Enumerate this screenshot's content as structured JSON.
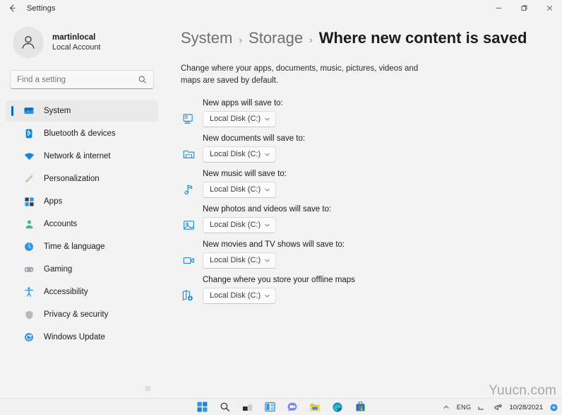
{
  "window": {
    "title": "Settings",
    "back_icon": "back-arrow-icon",
    "minimize_label": "─",
    "maximize_label": "❐",
    "close_label": "✕"
  },
  "sidebar": {
    "profile": {
      "name": "martinlocal",
      "subtitle": "Local Account",
      "avatar_icon": "person-avatar-icon"
    },
    "search": {
      "placeholder": "Find a setting",
      "value": "",
      "icon": "search-icon"
    },
    "items": [
      {
        "label": "System",
        "icon": "system-monitor-icon",
        "selected": true
      },
      {
        "label": "Bluetooth & devices",
        "icon": "bluetooth-icon",
        "selected": false
      },
      {
        "label": "Network & internet",
        "icon": "network-wifi-icon",
        "selected": false
      },
      {
        "label": "Personalization",
        "icon": "paintbrush-icon",
        "selected": false
      },
      {
        "label": "Apps",
        "icon": "apps-grid-icon",
        "selected": false
      },
      {
        "label": "Accounts",
        "icon": "accounts-person-icon",
        "selected": false
      },
      {
        "label": "Time & language",
        "icon": "clock-globe-icon",
        "selected": false
      },
      {
        "label": "Gaming",
        "icon": "gaming-controller-icon",
        "selected": false
      },
      {
        "label": "Accessibility",
        "icon": "accessibility-icon",
        "selected": false
      },
      {
        "label": "Privacy & security",
        "icon": "shield-icon",
        "selected": false
      },
      {
        "label": "Windows Update",
        "icon": "windows-update-icon",
        "selected": false
      }
    ]
  },
  "main": {
    "breadcrumb": {
      "root": "System",
      "parent": "Storage",
      "separator": "›",
      "current": "Where new content is saved"
    },
    "description": "Change where your apps, documents, music, pictures, videos and maps are saved by default.",
    "rows": [
      {
        "label": "New apps will save to:",
        "icon": "app-display-icon",
        "value": "Local Disk (C:)"
      },
      {
        "label": "New documents will save to:",
        "icon": "documents-folder-icon",
        "value": "Local Disk (C:)"
      },
      {
        "label": "New music will save to:",
        "icon": "music-note-icon",
        "value": "Local Disk (C:)"
      },
      {
        "label": "New photos and videos will save to:",
        "icon": "photo-image-icon",
        "value": "Local Disk (C:)"
      },
      {
        "label": "New movies and TV shows will save to:",
        "icon": "video-camera-icon",
        "value": "Local Disk (C:)"
      },
      {
        "label": "Change where you store your offline maps",
        "icon": "offline-maps-icon",
        "value": "Local Disk (C:)"
      }
    ],
    "chevron_icon": "chevron-down-icon"
  },
  "taskbar": {
    "items": [
      {
        "name": "start-button",
        "icon": "windows-start-icon"
      },
      {
        "name": "search-button",
        "icon": "search-icon"
      },
      {
        "name": "task-view-button",
        "icon": "task-view-icon"
      },
      {
        "name": "widgets-button",
        "icon": "widgets-icon"
      },
      {
        "name": "chat-button",
        "icon": "chat-teams-icon"
      },
      {
        "name": "file-explorer-button",
        "icon": "file-explorer-icon"
      },
      {
        "name": "edge-button",
        "icon": "microsoft-edge-icon"
      },
      {
        "name": "store-button",
        "icon": "microsoft-store-icon"
      }
    ],
    "tray": {
      "overflow_icon": "chevron-up-icon",
      "language": "ENG",
      "network_icon": "network-icon",
      "volume_icon": "volume-muted-icon",
      "clock": "10/28/2021",
      "notification_icon": "notification-icon"
    }
  },
  "watermark": {
    "text": "Yuucn.com"
  },
  "colors": {
    "accent": "#0067c0",
    "window_bg": "#f3f3f3",
    "selected_bg": "#e9e9e9",
    "text": "#1b1b1b",
    "muted_text": "#6e6e6e"
  }
}
